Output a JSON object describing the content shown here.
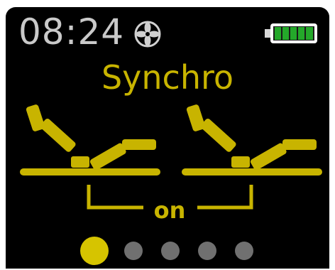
{
  "status_bar": {
    "time": "08:24",
    "fan_icon": "fan-icon",
    "battery_icon": "battery-full-icon",
    "battery_level": 1.0
  },
  "mode": {
    "title": "Synchro",
    "sync_state": "on"
  },
  "beds": {
    "left_icon": "bed-icon",
    "right_icon": "bed-icon"
  },
  "pager": {
    "page_count": 5,
    "current_page": 1
  },
  "colors": {
    "background": "#000000",
    "accent": "#c8b400",
    "clock": "#c9c9c9",
    "battery": "#24a82a",
    "inactive_dot": "#707070"
  }
}
